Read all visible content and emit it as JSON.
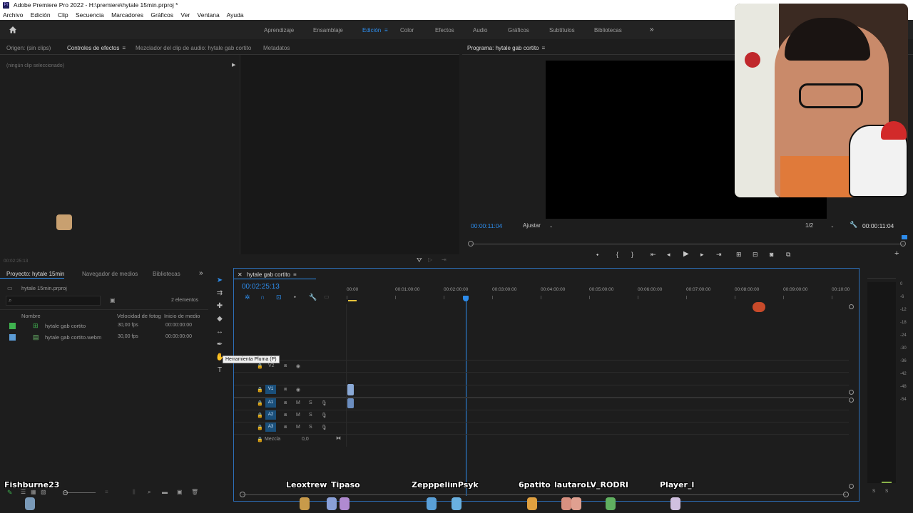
{
  "titlebar": {
    "app_title": "Adobe Premiere Pro 2022 - H:\\premiere\\hytale 15min.prproj *",
    "icon_label": "Pr"
  },
  "menu": [
    "Archivo",
    "Edición",
    "Clip",
    "Secuencia",
    "Marcadores",
    "Gráficos",
    "Ver",
    "Ventana",
    "Ayuda"
  ],
  "workspaces": {
    "items": [
      "Aprendizaje",
      "Ensamblaje",
      "Edición",
      "Color",
      "Efectos",
      "Audio",
      "Gráficos",
      "Subtítulos",
      "Bibliotecas"
    ],
    "active": "Edición",
    "more": "»"
  },
  "source_panel": {
    "tabs": [
      "Origen: (sin clips)",
      "Controles de efectos",
      "Mezclador del clip de audio: hytale gab cortito",
      "Metadatos"
    ],
    "active_tab": "Controles de efectos",
    "no_clip": "(ningún clip seleccionado)",
    "timecode": "00:02:25:13"
  },
  "program_monitor": {
    "title": "Programa: hytale gab cortito",
    "timecode_left": "00:00:11:04",
    "fit": "Ajustar",
    "resolution": "1/2",
    "timecode_right": "00:00:11:04"
  },
  "project_panel": {
    "tabs": [
      "Proyecto: hytale 15min",
      "Navegador de medios",
      "Bibliotecas"
    ],
    "file": "hytale 15min.prproj",
    "count": "2 elementos",
    "columns": [
      "Nombre",
      "Velocidad de fotog",
      "Inicio de medio"
    ],
    "rows": [
      {
        "name": "hytale gab cortito",
        "fps": "30,00 fps",
        "start": "00:00:00:00",
        "color": "#3fb34f"
      },
      {
        "name": "hytale gab cortito.webm",
        "fps": "30,00 fps",
        "start": "00:00:00:00",
        "color": "#5b9bd5"
      }
    ]
  },
  "timeline": {
    "title": "hytale gab cortito",
    "timecode": "00:02:25:13",
    "ruler": [
      "00:00",
      "00:01:00:00",
      "00:02:00:00",
      "00:03:00:00",
      "00:04:00:00",
      "00:05:00:00",
      "00:06:00:00",
      "00:07:00:00",
      "00:08:00:00",
      "00:09:00:00",
      "00:10:00"
    ],
    "video_tracks": [
      "V3",
      "V2",
      "V1"
    ],
    "audio_tracks": [
      "A1",
      "A2",
      "A3"
    ],
    "mute": "M",
    "solo": "S",
    "mix_label": "Mezcla",
    "mix_value": "0,0",
    "tooltip": "Herramienta Pluma (P)"
  },
  "meter_scale": [
    "0",
    "-6",
    "-12",
    "-18",
    "-24",
    "-30",
    "-36",
    "-42",
    "-48",
    "-54"
  ],
  "meter_buttons": [
    "S",
    "S"
  ],
  "overlay_names": [
    {
      "text": "Fishburne23"
    },
    {
      "text": "Leoxtrew"
    },
    {
      "text": "Tipaso"
    },
    {
      "text": "Zepppelin"
    },
    {
      "text": "nPsyk"
    },
    {
      "text": "6patito"
    },
    {
      "text": "lautaro"
    },
    {
      "text": "LV_RODRI"
    },
    {
      "text": "Player_l"
    }
  ],
  "colors": {
    "accent": "#2d8ceb",
    "track_blue": "#1a4f7a",
    "clip": "#8aa9d6"
  }
}
